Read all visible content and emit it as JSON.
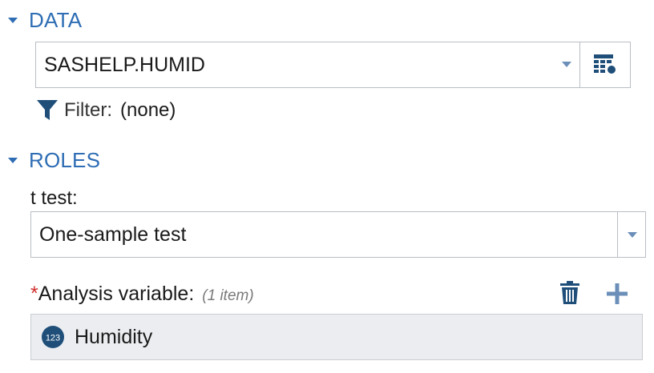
{
  "sections": {
    "data": {
      "title": "DATA"
    },
    "roles": {
      "title": "ROLES"
    }
  },
  "data_source": {
    "value": "SASHELP.HUMID"
  },
  "filter": {
    "label": "Filter:",
    "value": "(none)"
  },
  "ttest": {
    "label": "t test:",
    "selected": "One-sample test"
  },
  "analysis": {
    "required_marker": "*",
    "label": "Analysis variable:",
    "count": "(1 item)",
    "items": [
      {
        "name": "Humidity",
        "type_icon": "numeric-icon",
        "type_text": "123"
      }
    ]
  },
  "colors": {
    "accent": "#2e6db4",
    "required": "#d22f2f",
    "icon": "#1f4e79",
    "list_bg": "#ebedf0"
  },
  "icons": {
    "section_toggle": "caret-down-icon",
    "dropdown": "chevron-down-icon",
    "table_picker": "table-select-icon",
    "filter": "filter-icon",
    "remove": "trash-icon",
    "add": "plus-icon"
  }
}
